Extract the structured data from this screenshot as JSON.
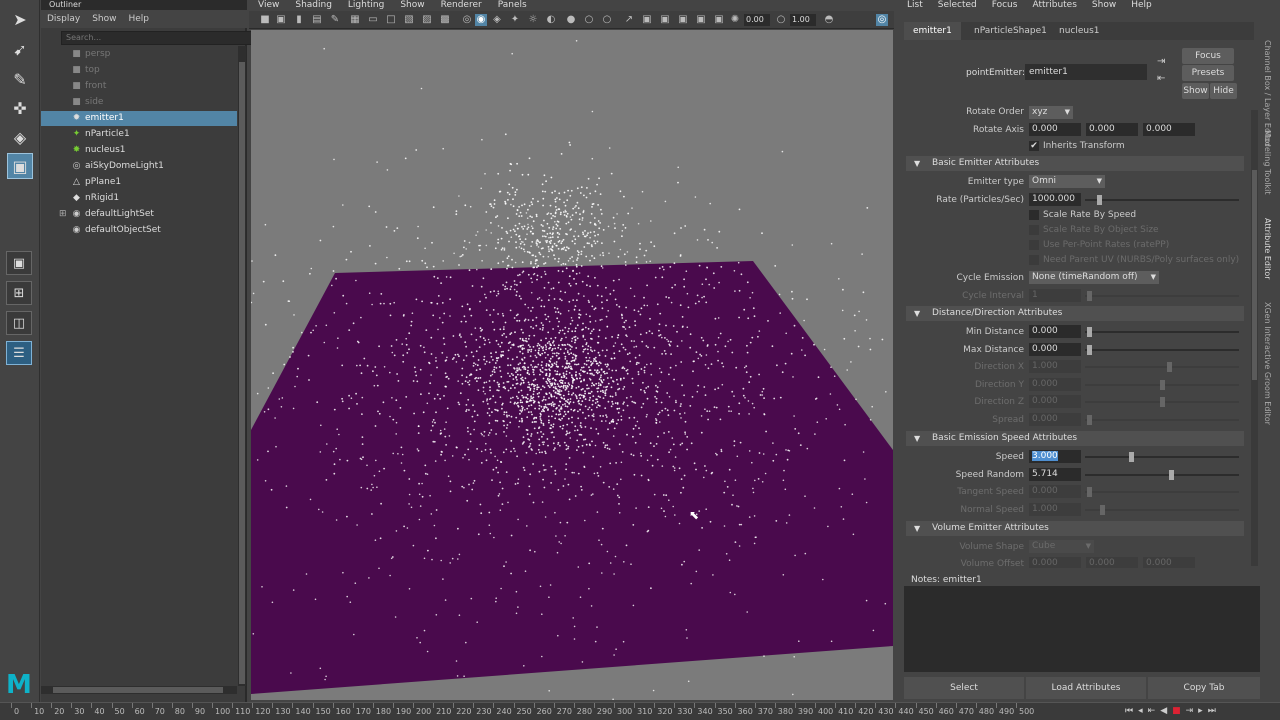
{
  "toolbox": {
    "tools": [
      "select-tool",
      "lasso-tool",
      "paint-tool",
      "move-tool",
      "rotate-tool",
      "scale-tool"
    ],
    "layouts": [
      "single-pane-layout",
      "four-pane-layout",
      "two-pane-layout",
      "outliner-layout"
    ]
  },
  "outliner": {
    "title": "Outliner",
    "menu": [
      "Display",
      "Show",
      "Help"
    ],
    "search_placeholder": "Search...",
    "items": [
      {
        "label": "persp",
        "icon": "camera-icon",
        "state": "dim"
      },
      {
        "label": "top",
        "icon": "camera-icon",
        "state": "dim"
      },
      {
        "label": "front",
        "icon": "camera-icon",
        "state": "dim"
      },
      {
        "label": "side",
        "icon": "camera-icon",
        "state": "dim"
      },
      {
        "label": "emitter1",
        "icon": "emitter-icon",
        "state": "selected"
      },
      {
        "label": "nParticle1",
        "icon": "nparticle-icon",
        "state": "normal"
      },
      {
        "label": "nucleus1",
        "icon": "nucleus-icon",
        "state": "normal"
      },
      {
        "label": "aiSkyDomeLight1",
        "icon": "light-icon",
        "state": "normal"
      },
      {
        "label": "pPlane1",
        "icon": "mesh-icon",
        "state": "normal"
      },
      {
        "label": "nRigid1",
        "icon": "nrigid-icon",
        "state": "normal"
      },
      {
        "label": "defaultLightSet",
        "icon": "set-icon",
        "state": "normal"
      },
      {
        "label": "defaultObjectSet",
        "icon": "set-icon",
        "state": "normal"
      }
    ]
  },
  "viewport": {
    "menu": [
      "View",
      "Shading",
      "Lighting",
      "Show",
      "Renderer",
      "Panels"
    ],
    "toolbar_value_1": "0.00",
    "toolbar_value_2": "1.00",
    "plane_color": "#4a0a4d",
    "background_color": "#7b7b7b"
  },
  "attribute_editor": {
    "menu": [
      "List",
      "Selected",
      "Focus",
      "Attributes",
      "Show",
      "Help"
    ],
    "tabs": [
      "emitter1",
      "nParticleShape1",
      "nucleus1"
    ],
    "node_type_label": "pointEmitter:",
    "node_name": "emitter1",
    "buttons": {
      "focus": "Focus",
      "presets": "Presets",
      "show": "Show",
      "hide": "Hide"
    },
    "rotate_order": {
      "label": "Rotate Order",
      "value": "xyz"
    },
    "rotate_axis": {
      "label": "Rotate Axis",
      "values": [
        "0.000",
        "0.000",
        "0.000"
      ]
    },
    "inherits_transform": {
      "label": "Inherits Transform",
      "checked": true
    },
    "sections": {
      "basic_emitter": "Basic Emitter Attributes",
      "distance_direction": "Distance/Direction Attributes",
      "basic_emission_speed": "Basic Emission Speed Attributes",
      "volume_emitter": "Volume Emitter Attributes"
    },
    "emitter_type": {
      "label": "Emitter type",
      "value": "Omni"
    },
    "rate": {
      "label": "Rate (Particles/Sec)",
      "value": "1000.000",
      "slider_fraction": 0.08
    },
    "checkboxes": [
      {
        "label": "Scale Rate By Speed",
        "enabled": true
      },
      {
        "label": "Scale Rate By Object Size",
        "enabled": false
      },
      {
        "label": "Use Per-Point Rates (ratePP)",
        "enabled": false
      },
      {
        "label": "Need Parent UV (NURBS/Poly surfaces only)",
        "enabled": false
      }
    ],
    "cycle_emission": {
      "label": "Cycle Emission",
      "value": "None (timeRandom off)"
    },
    "cycle_interval": {
      "label": "Cycle Interval",
      "value": "1"
    },
    "min_distance": {
      "label": "Min Distance",
      "value": "0.000"
    },
    "max_distance": {
      "label": "Max Distance",
      "value": "0.000"
    },
    "direction_x": {
      "label": "Direction X",
      "value": "1.000"
    },
    "direction_y": {
      "label": "Direction Y",
      "value": "0.000"
    },
    "direction_z": {
      "label": "Direction Z",
      "value": "0.000"
    },
    "spread": {
      "label": "Spread",
      "value": "0.000"
    },
    "speed": {
      "label": "Speed",
      "value": "3.000",
      "slider_fraction": 0.3
    },
    "speed_random": {
      "label": "Speed Random",
      "value": "5.714",
      "slider_fraction": 0.57
    },
    "tangent_speed": {
      "label": "Tangent Speed",
      "value": "0.000"
    },
    "normal_speed": {
      "label": "Normal Speed",
      "value": "1.000"
    },
    "volume_shape": {
      "label": "Volume Shape",
      "value": "Cube"
    },
    "volume_offset": {
      "label": "Volume Offset",
      "values": [
        "0.000",
        "0.000",
        "0.000"
      ]
    },
    "notes_label": "Notes:  emitter1",
    "bottom_buttons": {
      "select": "Select",
      "load": "Load Attributes",
      "copy": "Copy Tab"
    },
    "side_tabs": [
      "Channel Box / Layer Editor",
      "Modeling Toolkit",
      "Attribute Editor",
      "XGen Interactive Groom Editor"
    ]
  },
  "timeline": {
    "ticks": [
      "0",
      "10",
      "20",
      "30",
      "40",
      "50",
      "60",
      "70",
      "80",
      "90",
      "100",
      "110",
      "120",
      "130",
      "140",
      "150",
      "160",
      "170",
      "180",
      "190",
      "200",
      "210",
      "220",
      "230",
      "240",
      "250",
      "260",
      "270",
      "280",
      "290",
      "300",
      "310",
      "320",
      "330",
      "340",
      "350",
      "360",
      "370",
      "380",
      "390",
      "400",
      "410",
      "420",
      "430",
      "440",
      "450",
      "460",
      "470",
      "480",
      "490",
      "500"
    ],
    "playback": [
      "to-start-icon",
      "step-back-icon",
      "key-back-icon",
      "play-back-icon",
      "stop-icon",
      "key-forward-icon",
      "step-forward-icon",
      "to-end-icon"
    ]
  },
  "app_logo": "M"
}
